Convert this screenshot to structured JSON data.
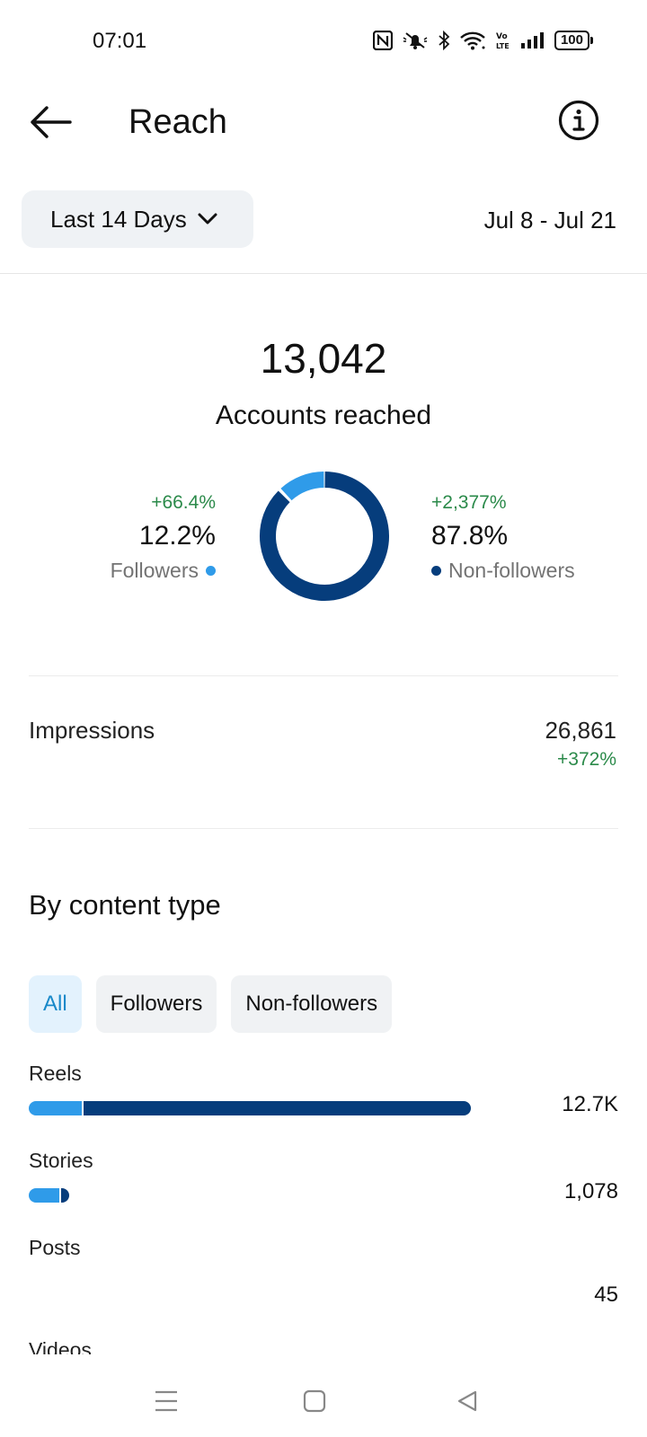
{
  "status_bar": {
    "time": "07:01",
    "battery": "100",
    "icons": [
      "nfc-icon",
      "mute-icon",
      "bluetooth-icon",
      "wifi-icon",
      "volte-icon",
      "signal-icon",
      "battery-icon"
    ]
  },
  "header": {
    "title": "Reach"
  },
  "filter": {
    "range_label": "Last 14 Days",
    "date_range": "Jul 8 - Jul 21"
  },
  "summary": {
    "total": "13,042",
    "total_label": "Accounts reached",
    "followers": {
      "change": "+66.4%",
      "percent": "12.2%",
      "label": "Followers",
      "fraction": 0.122
    },
    "non_followers": {
      "change": "+2,377%",
      "percent": "87.8%",
      "label": "Non-followers",
      "fraction": 0.878
    }
  },
  "impressions": {
    "label": "Impressions",
    "value": "26,861",
    "change": "+372%"
  },
  "content_type": {
    "title": "By content type",
    "chips": [
      "All",
      "Followers",
      "Non-followers"
    ],
    "active_chip": "All",
    "rows": [
      {
        "label": "Reels",
        "value": "12.7K",
        "followers_fraction": 0.12,
        "total_fraction": 1.0
      },
      {
        "label": "Stories",
        "value": "1,078",
        "followers_fraction": 0.75,
        "total_fraction": 0.091
      },
      {
        "label": "Posts",
        "value": "45",
        "followers_fraction": 0,
        "total_fraction": 0
      }
    ],
    "next_label": "Videos"
  },
  "colors": {
    "followers": "#2f9be9",
    "non_followers": "#063d7c",
    "positive_change": "#2b8a4a",
    "chip_active_bg": "#e3f2fd",
    "chip_active_text": "#1889c9"
  }
}
